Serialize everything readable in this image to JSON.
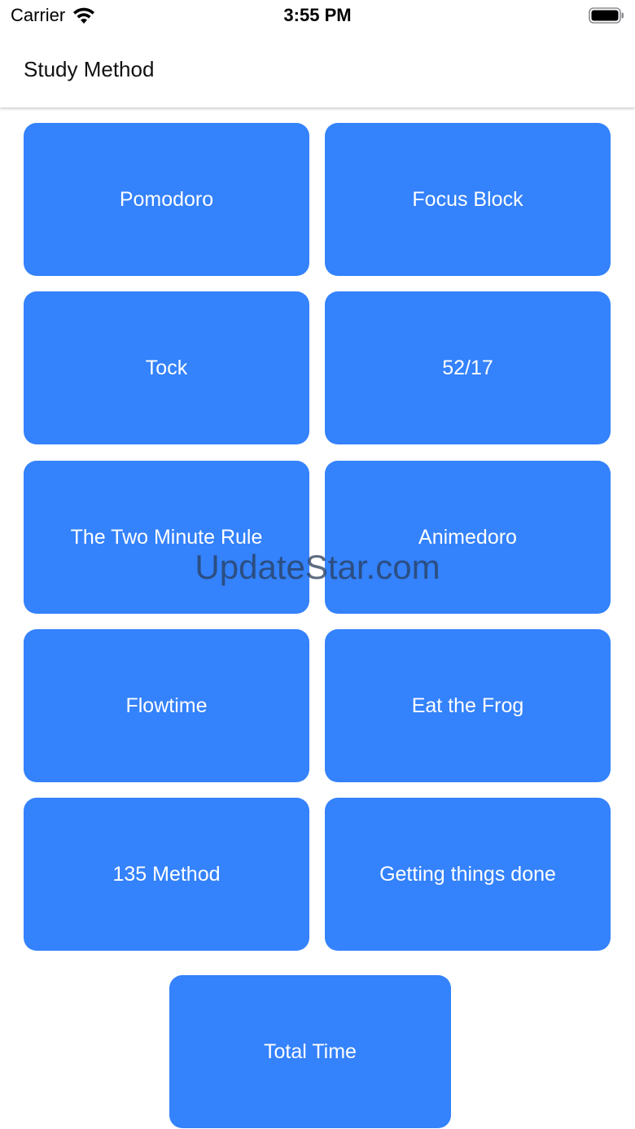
{
  "status_bar": {
    "carrier": "Carrier",
    "time": "3:55 PM",
    "icons": [
      "wifi-icon",
      "battery-icon"
    ]
  },
  "nav": {
    "title": "Study Method"
  },
  "methods": [
    {
      "label": "Pomodoro"
    },
    {
      "label": "Focus Block"
    },
    {
      "label": "Tock"
    },
    {
      "label": "52/17"
    },
    {
      "label": "The Two Minute Rule"
    },
    {
      "label": "Animedoro"
    },
    {
      "label": "Flowtime"
    },
    {
      "label": "Eat the Frog"
    },
    {
      "label": "135 Method"
    },
    {
      "label": "Getting things done"
    }
  ],
  "total_button": {
    "label": "Total Time"
  },
  "watermark": "UpdateStar.com",
  "colors": {
    "button_blue": "#3482fc",
    "button_text": "#ffffff",
    "background": "#ffffff"
  }
}
